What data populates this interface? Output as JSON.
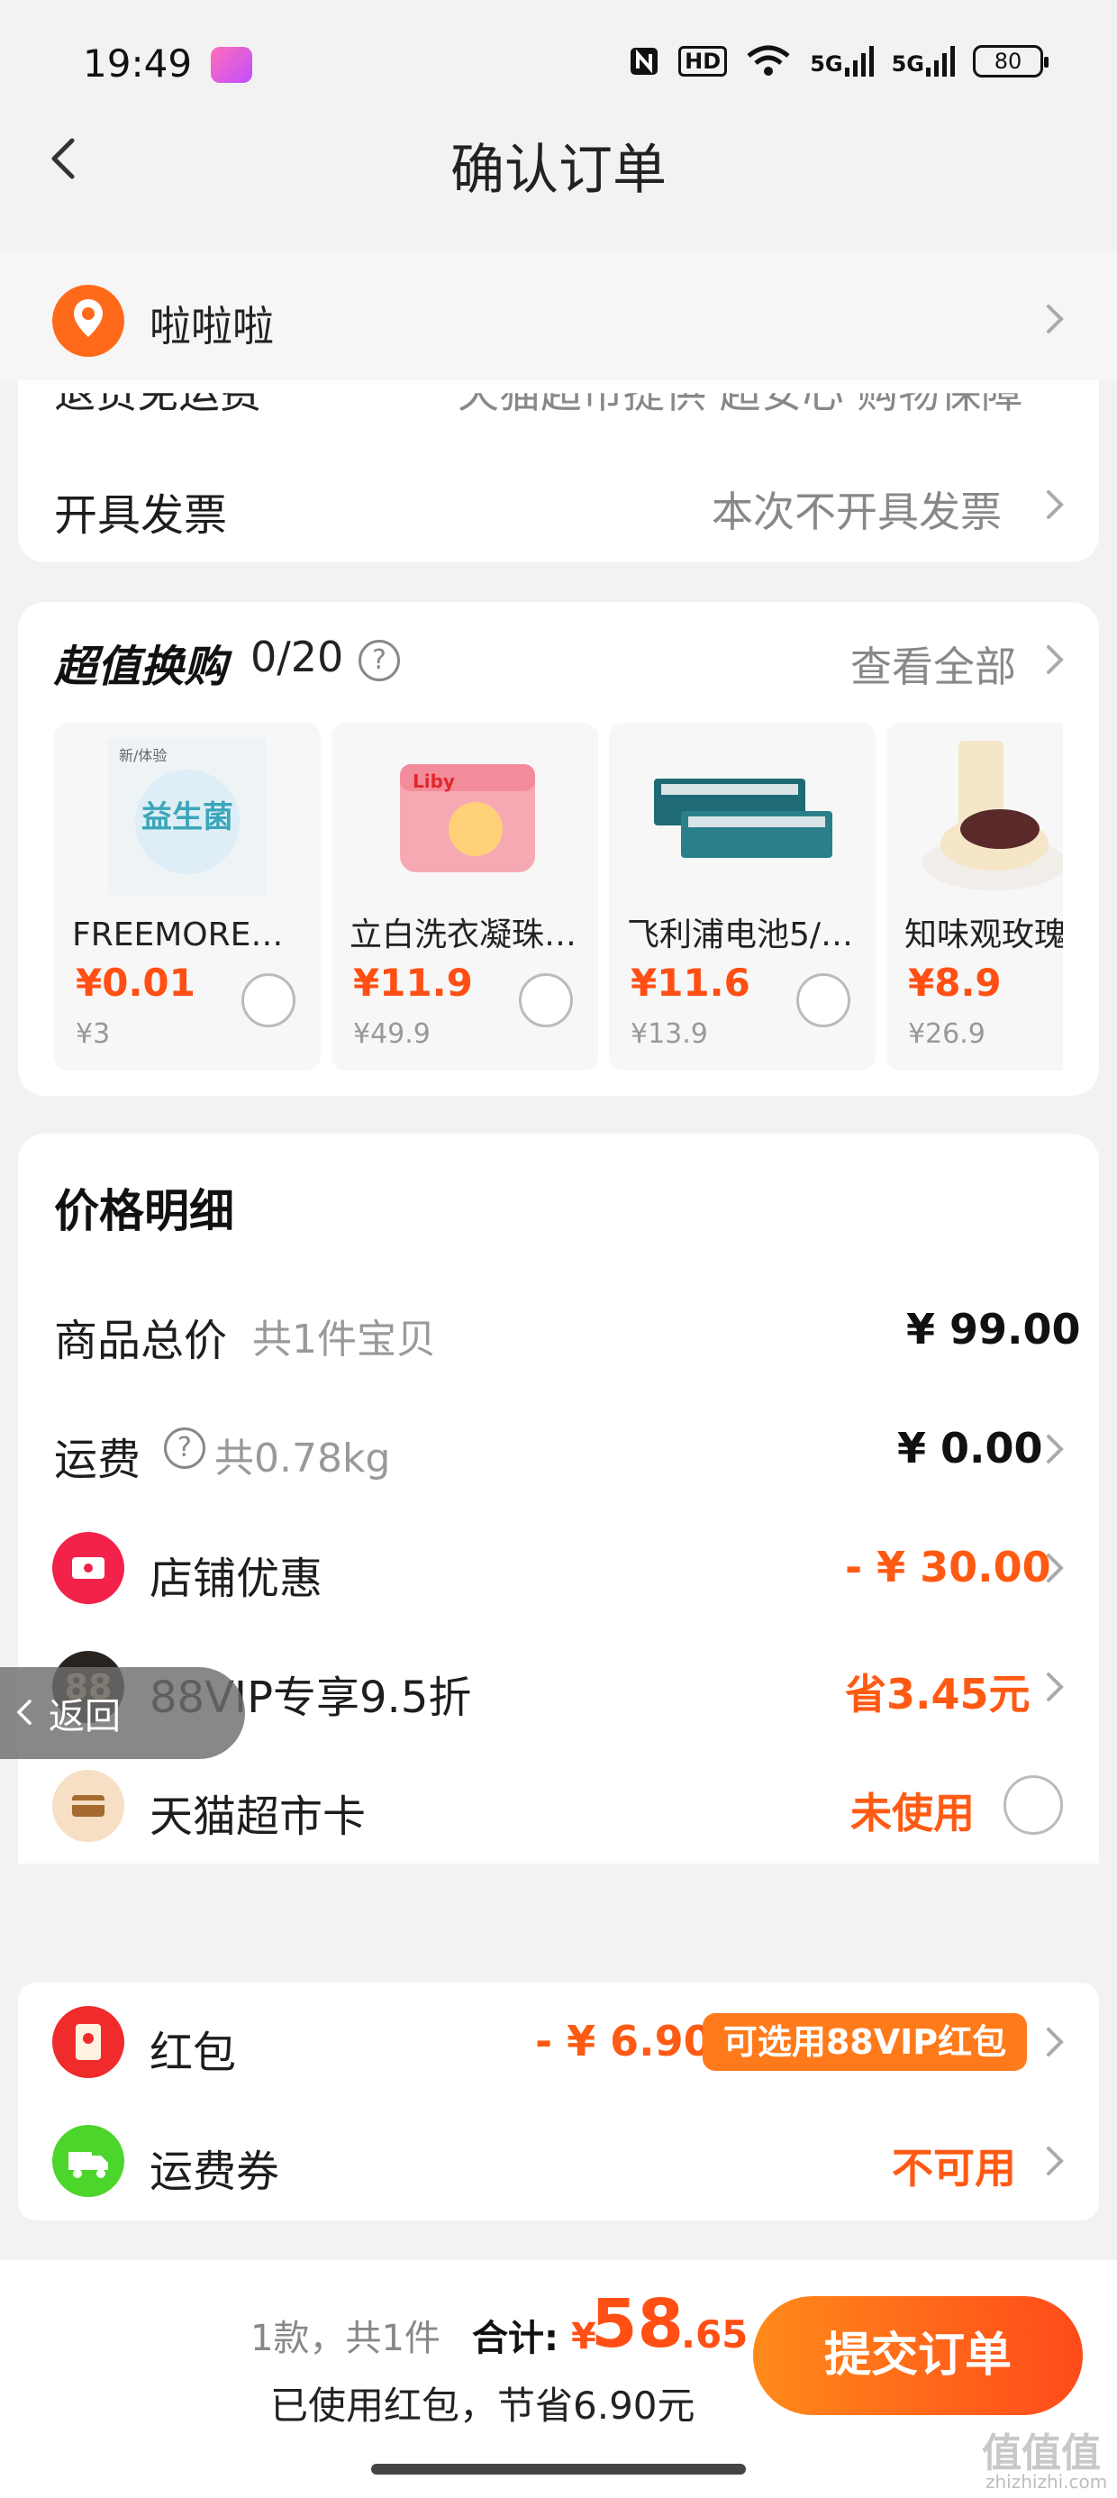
{
  "status_bar": {
    "time": "19:49",
    "icons": [
      "nfc-icon",
      "hd-icon",
      "wifi-icon",
      "5g-icon",
      "5g-icon"
    ],
    "hd_label": "HD",
    "g1": "5G",
    "g2": "5G",
    "battery": "80"
  },
  "header": {
    "title": "确认订单"
  },
  "address": {
    "name": "啦啦啦"
  },
  "order_info": {
    "return_label": "退货免运费",
    "return_value": "天猫超市提供 超安心 购物保障",
    "invoice_label": "开具发票",
    "invoice_value": "本次不开具发票"
  },
  "swap": {
    "title": "超值换购",
    "count": "0/20",
    "see_all": "查看全部",
    "items": [
      {
        "name": "FREEMORE自…",
        "price": "¥0.01",
        "orig": "¥3"
      },
      {
        "name": "立白洗衣凝珠…",
        "price": "¥11.9",
        "orig": "¥49.9"
      },
      {
        "name": "飞利浦电池5/…",
        "price": "¥11.6",
        "orig": "¥13.9"
      },
      {
        "name": "知味观玫瑰",
        "price": "¥8.9",
        "orig": "¥26.9"
      }
    ],
    "img_texts": {
      "p1_tag": "新/体验",
      "p1_big": "益生菌",
      "p2_brand": "Liby"
    }
  },
  "price_detail": {
    "title": "价格明细",
    "goods_total_label": "商品总价",
    "goods_total_sub": "共1件宝贝",
    "goods_total_value": "¥ 99.00",
    "shipping_label": "运费",
    "shipping_sub": "共0.78kg",
    "shipping_value": "¥ 0.00",
    "store_discount_label": "店铺优惠",
    "store_discount_value": "- ¥ 30.00",
    "vip_label": "88VIP专享9.5折",
    "vip_value": "省3.45元",
    "card_label": "天猫超市卡",
    "card_value": "未使用",
    "vip_badge": "88"
  },
  "float_back": {
    "label": "返回"
  },
  "coupons": {
    "redpacket_label": "红包",
    "redpacket_value": "- ¥ 6.90",
    "redpacket_pill": "可选用88VIP红包",
    "shipping_coupon_label": "运费券",
    "shipping_coupon_value": "不可用"
  },
  "bottom_bar": {
    "count_text": "1款，共1件",
    "total_label": "合计:",
    "currency": "¥",
    "total_int": "58",
    "total_dec": ".65",
    "note": "已使用红包，节省6.90元",
    "submit_label": "提交订单"
  },
  "watermark": {
    "main": "值值值",
    "sub": "zhizhizhi.com"
  },
  "colors": {
    "accent": "#ff5a14",
    "submit_gradient_start": "#ff8a1a",
    "submit_gradient_end": "#ff4a1a",
    "page_bg": "#f2f2f2"
  }
}
